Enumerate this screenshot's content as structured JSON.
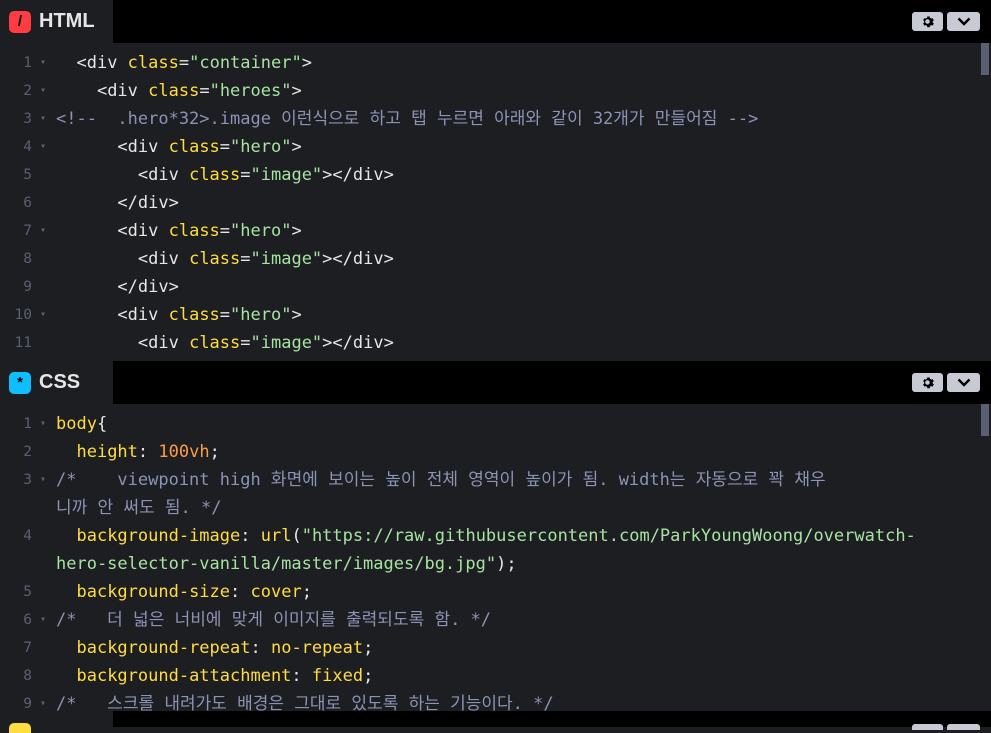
{
  "html_panel": {
    "title": "HTML",
    "icon_glyph": "/",
    "icon_color": "#ff3c41",
    "lines": [
      {
        "n": "1",
        "fold": true,
        "indent": "  ",
        "tokens": [
          [
            "tag",
            "<div "
          ],
          [
            "attr",
            "class"
          ],
          [
            "tag",
            "="
          ],
          [
            "str",
            "\"container\""
          ],
          [
            "tag",
            ">"
          ]
        ]
      },
      {
        "n": "2",
        "fold": true,
        "indent": "    ",
        "tokens": [
          [
            "tag",
            "<div "
          ],
          [
            "attr",
            "class"
          ],
          [
            "tag",
            "="
          ],
          [
            "str",
            "\"heroes\""
          ],
          [
            "tag",
            ">"
          ]
        ]
      },
      {
        "n": "3",
        "fold": true,
        "indent": "",
        "tokens": [
          [
            "cm",
            "<!--  .hero*32>.image 이런식으로 하고 탭 누르면 아래와 같이 32개가 만들어짐 -->"
          ]
        ]
      },
      {
        "n": "4",
        "fold": true,
        "indent": "      ",
        "tokens": [
          [
            "tag",
            "<div "
          ],
          [
            "attr",
            "class"
          ],
          [
            "tag",
            "="
          ],
          [
            "str",
            "\"hero\""
          ],
          [
            "tag",
            ">"
          ]
        ]
      },
      {
        "n": "5",
        "fold": false,
        "indent": "        ",
        "tokens": [
          [
            "tag",
            "<div "
          ],
          [
            "attr",
            "class"
          ],
          [
            "tag",
            "="
          ],
          [
            "str",
            "\"image\""
          ],
          [
            "tag",
            "></div>"
          ]
        ]
      },
      {
        "n": "6",
        "fold": false,
        "indent": "      ",
        "tokens": [
          [
            "tag",
            "</div>"
          ]
        ]
      },
      {
        "n": "7",
        "fold": true,
        "indent": "      ",
        "tokens": [
          [
            "tag",
            "<div "
          ],
          [
            "attr",
            "class"
          ],
          [
            "tag",
            "="
          ],
          [
            "str",
            "\"hero\""
          ],
          [
            "tag",
            ">"
          ]
        ]
      },
      {
        "n": "8",
        "fold": false,
        "indent": "        ",
        "tokens": [
          [
            "tag",
            "<div "
          ],
          [
            "attr",
            "class"
          ],
          [
            "tag",
            "="
          ],
          [
            "str",
            "\"image\""
          ],
          [
            "tag",
            "></div>"
          ]
        ]
      },
      {
        "n": "9",
        "fold": false,
        "indent": "      ",
        "tokens": [
          [
            "tag",
            "</div>"
          ]
        ]
      },
      {
        "n": "10",
        "fold": true,
        "indent": "      ",
        "tokens": [
          [
            "tag",
            "<div "
          ],
          [
            "attr",
            "class"
          ],
          [
            "tag",
            "="
          ],
          [
            "str",
            "\"hero\""
          ],
          [
            "tag",
            ">"
          ]
        ]
      },
      {
        "n": "11",
        "fold": false,
        "indent": "        ",
        "tokens": [
          [
            "tag",
            "<div "
          ],
          [
            "attr",
            "class"
          ],
          [
            "tag",
            "="
          ],
          [
            "str",
            "\"image\""
          ],
          [
            "tag",
            "></div>"
          ]
        ]
      }
    ]
  },
  "css_panel": {
    "title": "CSS",
    "icon_glyph": "*",
    "icon_color": "#0ebeff",
    "lines": [
      {
        "n": "1",
        "fold": true,
        "indent": "",
        "tokens": [
          [
            "sel",
            "body"
          ],
          [
            "val",
            "{"
          ]
        ]
      },
      {
        "n": "2",
        "fold": false,
        "indent": "  ",
        "tokens": [
          [
            "prop",
            "height"
          ],
          [
            "val",
            ": "
          ],
          [
            "num",
            "100vh"
          ],
          [
            "val",
            ";"
          ]
        ]
      },
      {
        "n": "3",
        "fold": true,
        "indent": "",
        "tokens": [
          [
            "cm",
            "/*    viewpoint high 화면에 보이는 높이 전체 영역이 높이가 됨. width는 자동으로 꽉 채우"
          ]
        ]
      },
      {
        "n": "",
        "fold": false,
        "indent": "",
        "tokens": [
          [
            "cm",
            "니까 안 써도 됨. */"
          ]
        ]
      },
      {
        "n": "4",
        "fold": false,
        "indent": "  ",
        "tokens": [
          [
            "prop",
            "background-image"
          ],
          [
            "val",
            ": "
          ],
          [
            "kw",
            "url"
          ],
          [
            "val",
            "("
          ],
          [
            "str",
            "\"https://raw.githubusercontent.com/ParkYoungWoong/overwatch-"
          ]
        ]
      },
      {
        "n": "",
        "fold": false,
        "indent": "",
        "tokens": [
          [
            "str",
            "hero-selector-vanilla/master/images/bg.jpg\""
          ],
          [
            "val",
            ");"
          ]
        ]
      },
      {
        "n": "5",
        "fold": false,
        "indent": "  ",
        "tokens": [
          [
            "prop",
            "background-size"
          ],
          [
            "val",
            ": "
          ],
          [
            "kw",
            "cover"
          ],
          [
            "val",
            ";"
          ]
        ]
      },
      {
        "n": "6",
        "fold": true,
        "indent": "",
        "tokens": [
          [
            "cm",
            "/*   더 넓은 너비에 맞게 이미지를 출력되도록 함. */"
          ]
        ]
      },
      {
        "n": "7",
        "fold": false,
        "indent": "  ",
        "tokens": [
          [
            "prop",
            "background-repeat"
          ],
          [
            "val",
            ": "
          ],
          [
            "kw",
            "no-repeat"
          ],
          [
            "val",
            ";"
          ]
        ]
      },
      {
        "n": "8",
        "fold": false,
        "indent": "  ",
        "tokens": [
          [
            "prop",
            "background-attachment"
          ],
          [
            "val",
            ": "
          ],
          [
            "kw",
            "fixed"
          ],
          [
            "val",
            ";"
          ]
        ]
      },
      {
        "n": "9",
        "fold": true,
        "indent": "",
        "tokens": [
          [
            "cm",
            "/*   스크롤 내려가도 배경은 그대로 있도록 하는 기능이다. */"
          ]
        ]
      }
    ]
  },
  "icons": {
    "settings": "gear-icon",
    "collapse": "chevron-down-icon"
  }
}
